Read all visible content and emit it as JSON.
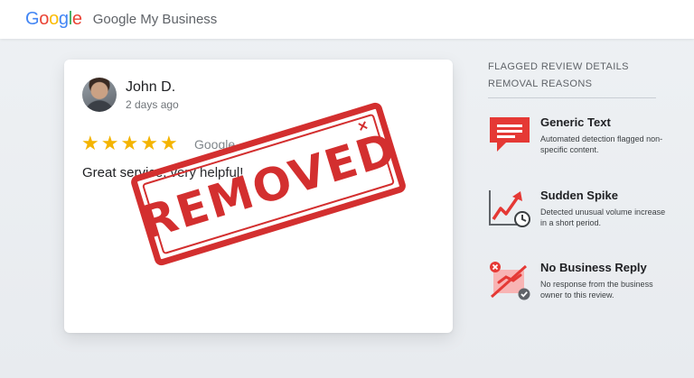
{
  "header": {
    "logo_letters": [
      "G",
      "o",
      "o",
      "g",
      "l",
      "e"
    ],
    "logo_colors": [
      "#4285F4",
      "#EA4335",
      "#FBBC05",
      "#4285F4",
      "#34A853",
      "#EA4335"
    ],
    "product_name": "Google My Business"
  },
  "review": {
    "reviewer_name": "John D.",
    "date": "2 days ago",
    "rating": 5,
    "source": "Google",
    "text": "Great service, very helpful!"
  },
  "stamp": {
    "text": "REMOVED",
    "mark": "×",
    "color": "#D32F2F"
  },
  "panel": {
    "heading_1": "FLAGGED REVIEW DETAILS",
    "heading_2": "REMOVAL REASONS",
    "reasons": [
      {
        "title": "Generic Text",
        "description": "Automated detection flagged non-specific content.",
        "icon": "chat-bubble-icon"
      },
      {
        "title": "Sudden Spike",
        "description": "Detected unusual volume increase in a short period.",
        "icon": "trend-spike-clock-icon"
      },
      {
        "title": "No Business Reply",
        "description": "No response from the business owner to this review.",
        "icon": "no-handshake-icon"
      }
    ]
  }
}
